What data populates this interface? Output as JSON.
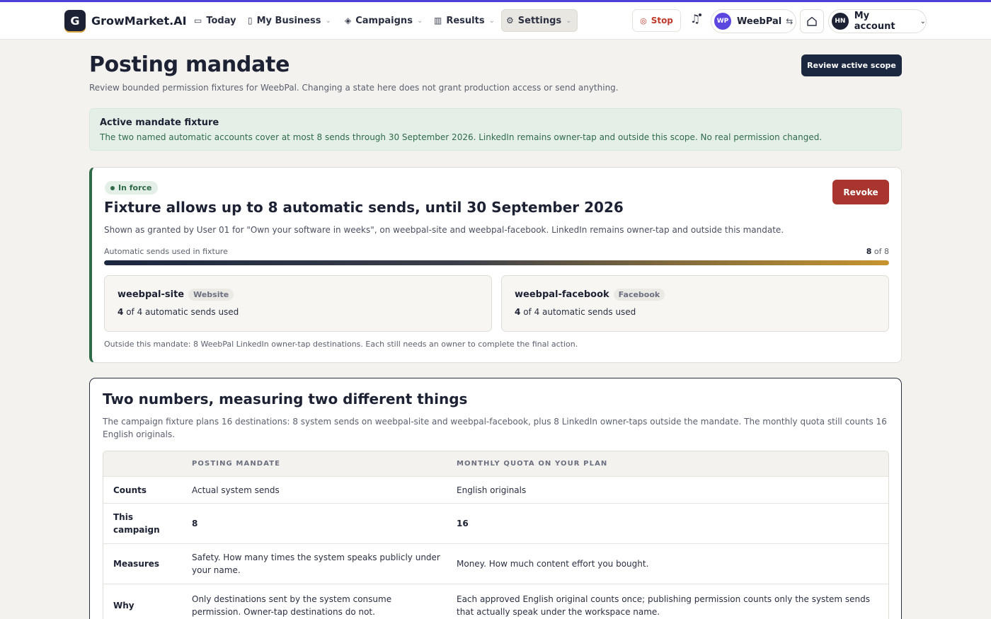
{
  "nav": {
    "brand_letter": "G",
    "brand_name": "GrowMarket.AI",
    "items": [
      {
        "label": "Today",
        "icon": "inbox-icon"
      },
      {
        "label": "My Business",
        "icon": "tablet-icon"
      },
      {
        "label": "Campaigns",
        "icon": "layers-icon"
      },
      {
        "label": "Results",
        "icon": "bar-chart-icon"
      },
      {
        "label": "Settings",
        "icon": "gear-icon"
      }
    ],
    "stop_label": "Stop",
    "workspace_initials": "WP",
    "workspace_name": "WeebPal",
    "account_initials": "HN",
    "account_label": "My account"
  },
  "header": {
    "title": "Posting mandate",
    "subtitle": "Review bounded permission fixtures for WeebPal. Changing a state here does not grant production access or send anything.",
    "review_button": "Review active scope"
  },
  "notice": {
    "title": "Active mandate fixture",
    "body": "The two named automatic accounts cover at most 8 sends through 30 September 2026. LinkedIn remains owner-tap and outside this scope. No real permission changed."
  },
  "mandate": {
    "badge": "In force",
    "revoke_label": "Revoke",
    "title": "Fixture allows up to 8 automatic sends, until 30 September 2026",
    "description": "Shown as granted by User 01 for \"Own your software in weeks\", on weebpal-site and weebpal-facebook. LinkedIn remains owner-tap and outside this mandate.",
    "usage_label": "Automatic sends used in fixture",
    "usage_used": "8",
    "usage_of": "of 8",
    "usage_fraction": 1.0,
    "destinations": [
      {
        "name": "weebpal-site",
        "tag": "Website",
        "used": "4",
        "used_text": "of 4 automatic sends used"
      },
      {
        "name": "weebpal-facebook",
        "tag": "Facebook",
        "used": "4",
        "used_text": "of 4 automatic sends used"
      }
    ],
    "outside_note": "Outside this mandate: 8 WeebPal LinkedIn owner-tap destinations. Each still needs an owner to complete the final action."
  },
  "compare": {
    "title": "Two numbers, measuring two different things",
    "description": "The campaign fixture plans 16 destinations: 8 system sends on weebpal-site and weebpal-facebook, plus 8 LinkedIn owner-taps outside the mandate. The monthly quota still counts 16 English originals.",
    "col_mandate": "POSTING MANDATE",
    "col_quota": "MONTHLY QUOTA ON YOUR PLAN",
    "rows": [
      {
        "label": "Counts",
        "mandate": "Actual system sends",
        "quota": "English originals"
      },
      {
        "label": "This campaign",
        "mandate": "8",
        "quota": "16"
      },
      {
        "label": "Measures",
        "mandate": "Safety. How many times the system speaks publicly under your name.",
        "quota": "Money. How much content effort you bought."
      },
      {
        "label": "Why",
        "mandate": "Only destinations sent by the system consume permission. Owner-tap destinations do not.",
        "quota": "Each approved English original counts once; publishing permission counts only the system sends that actually speak under the workspace name."
      }
    ]
  },
  "colors": {
    "primary": "#1c2740",
    "success": "#2f6b47",
    "danger": "#a8362e",
    "accent": "#5b46e0"
  }
}
